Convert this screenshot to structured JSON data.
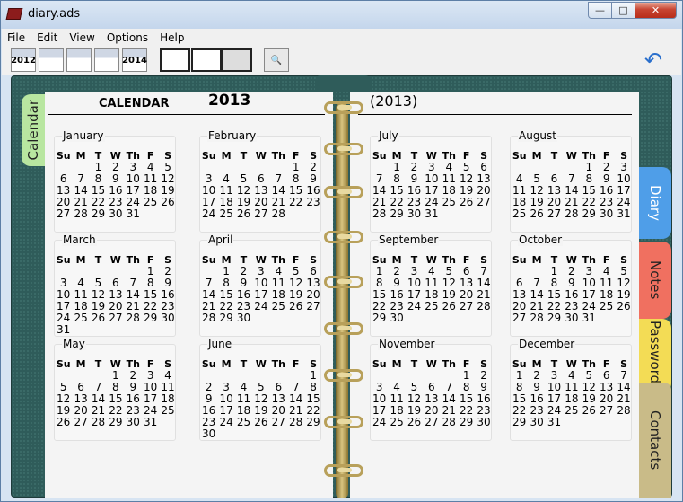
{
  "window": {
    "title": "diary.ads",
    "minimize": "—",
    "maximize": "□",
    "close": "✕"
  },
  "menu": [
    "File",
    "Edit",
    "View",
    "Options",
    "Help"
  ],
  "toolbar": {
    "year_prev": "2012",
    "year_next": "2014"
  },
  "left_page": {
    "label": "CALENDAR",
    "year": "2013"
  },
  "right_page": {
    "year": "(2013)"
  },
  "tabs": {
    "calendar": "Calendar",
    "diary": "Diary",
    "notes": "Notes",
    "passwords": "Passwords",
    "contacts": "Contacts"
  },
  "weekdays": [
    "Su",
    "M",
    "T",
    "W",
    "Th",
    "F",
    "S"
  ],
  "months": [
    {
      "name": "January",
      "weeks": [
        [
          "",
          "",
          "1",
          "2",
          "3",
          "4",
          "5"
        ],
        [
          "6",
          "7",
          "8",
          "9",
          "10",
          "11",
          "12"
        ],
        [
          "13",
          "14",
          "15",
          "16",
          "17",
          "18",
          "19"
        ],
        [
          "20",
          "21",
          "22",
          "23",
          "24",
          "25",
          "26"
        ],
        [
          "27",
          "28",
          "29",
          "30",
          "31",
          "",
          ""
        ]
      ]
    },
    {
      "name": "February",
      "weeks": [
        [
          "",
          "",
          "",
          "",
          "",
          "1",
          "2"
        ],
        [
          "3",
          "4",
          "5",
          "6",
          "7",
          "8",
          "9"
        ],
        [
          "10",
          "11",
          "12",
          "13",
          "14",
          "15",
          "16"
        ],
        [
          "17",
          "18",
          "19",
          "20",
          "21",
          "22",
          "23"
        ],
        [
          "24",
          "25",
          "26",
          "27",
          "28",
          "",
          ""
        ]
      ]
    },
    {
      "name": "March",
      "weeks": [
        [
          "",
          "",
          "",
          "",
          "",
          "1",
          "2"
        ],
        [
          "3",
          "4",
          "5",
          "6",
          "7",
          "8",
          "9"
        ],
        [
          "10",
          "11",
          "12",
          "13",
          "14",
          "15",
          "16"
        ],
        [
          "17",
          "18",
          "19",
          "20",
          "21",
          "22",
          "23"
        ],
        [
          "24",
          "25",
          "26",
          "27",
          "28",
          "29",
          "30"
        ],
        [
          "31",
          "",
          "",
          "",
          "",
          "",
          ""
        ]
      ]
    },
    {
      "name": "April",
      "weeks": [
        [
          "",
          "1",
          "2",
          "3",
          "4",
          "5",
          "6"
        ],
        [
          "7",
          "8",
          "9",
          "10",
          "11",
          "12",
          "13"
        ],
        [
          "14",
          "15",
          "16",
          "17",
          "18",
          "19",
          "20"
        ],
        [
          "21",
          "22",
          "23",
          "24",
          "25",
          "26",
          "27"
        ],
        [
          "28",
          "29",
          "30",
          "",
          "",
          "",
          ""
        ]
      ]
    },
    {
      "name": "May",
      "weeks": [
        [
          "",
          "",
          "",
          "1",
          "2",
          "3",
          "4"
        ],
        [
          "5",
          "6",
          "7",
          "8",
          "9",
          "10",
          "11"
        ],
        [
          "12",
          "13",
          "14",
          "15",
          "16",
          "17",
          "18"
        ],
        [
          "19",
          "20",
          "21",
          "22",
          "23",
          "24",
          "25"
        ],
        [
          "26",
          "27",
          "28",
          "29",
          "30",
          "31",
          ""
        ]
      ]
    },
    {
      "name": "June",
      "weeks": [
        [
          "",
          "",
          "",
          "",
          "",
          "",
          "1"
        ],
        [
          "2",
          "3",
          "4",
          "5",
          "6",
          "7",
          "8"
        ],
        [
          "9",
          "10",
          "11",
          "12",
          "13",
          "14",
          "15"
        ],
        [
          "16",
          "17",
          "18",
          "19",
          "20",
          "21",
          "22"
        ],
        [
          "23",
          "24",
          "25",
          "26",
          "27",
          "28",
          "29"
        ],
        [
          "30",
          "",
          "",
          "",
          "",
          "",
          ""
        ]
      ]
    },
    {
      "name": "July",
      "weeks": [
        [
          "",
          "1",
          "2",
          "3",
          "4",
          "5",
          "6"
        ],
        [
          "7",
          "8",
          "9",
          "10",
          "11",
          "12",
          "13"
        ],
        [
          "14",
          "15",
          "16",
          "17",
          "18",
          "19",
          "20"
        ],
        [
          "21",
          "22",
          "23",
          "24",
          "25",
          "26",
          "27"
        ],
        [
          "28",
          "29",
          "30",
          "31",
          "",
          "",
          ""
        ]
      ]
    },
    {
      "name": "August",
      "weeks": [
        [
          "",
          "",
          "",
          "",
          "1",
          "2",
          "3"
        ],
        [
          "4",
          "5",
          "6",
          "7",
          "8",
          "9",
          "10"
        ],
        [
          "11",
          "12",
          "13",
          "14",
          "15",
          "16",
          "17"
        ],
        [
          "18",
          "19",
          "20",
          "21",
          "22",
          "23",
          "24"
        ],
        [
          "25",
          "26",
          "27",
          "28",
          "29",
          "30",
          "31"
        ]
      ]
    },
    {
      "name": "September",
      "weeks": [
        [
          "1",
          "2",
          "3",
          "4",
          "5",
          "6",
          "7"
        ],
        [
          "8",
          "9",
          "10",
          "11",
          "12",
          "13",
          "14"
        ],
        [
          "15",
          "16",
          "17",
          "18",
          "19",
          "20",
          "21"
        ],
        [
          "22",
          "23",
          "24",
          "25",
          "26",
          "27",
          "28"
        ],
        [
          "29",
          "30",
          "",
          "",
          "",
          "",
          ""
        ]
      ]
    },
    {
      "name": "October",
      "weeks": [
        [
          "",
          "",
          "1",
          "2",
          "3",
          "4",
          "5"
        ],
        [
          "6",
          "7",
          "8",
          "9",
          "10",
          "11",
          "12"
        ],
        [
          "13",
          "14",
          "15",
          "16",
          "17",
          "18",
          "19"
        ],
        [
          "20",
          "21",
          "22",
          "23",
          "24",
          "25",
          "26"
        ],
        [
          "27",
          "28",
          "29",
          "30",
          "31",
          "",
          ""
        ]
      ]
    },
    {
      "name": "November",
      "weeks": [
        [
          "",
          "",
          "",
          "",
          "",
          "1",
          "2"
        ],
        [
          "3",
          "4",
          "5",
          "6",
          "7",
          "8",
          "9"
        ],
        [
          "10",
          "11",
          "12",
          "13",
          "14",
          "15",
          "16"
        ],
        [
          "17",
          "18",
          "19",
          "20",
          "21",
          "22",
          "23"
        ],
        [
          "24",
          "25",
          "26",
          "27",
          "28",
          "29",
          "30"
        ]
      ]
    },
    {
      "name": "December",
      "weeks": [
        [
          "1",
          "2",
          "3",
          "4",
          "5",
          "6",
          "7"
        ],
        [
          "8",
          "9",
          "10",
          "11",
          "12",
          "13",
          "14"
        ],
        [
          "15",
          "16",
          "17",
          "18",
          "19",
          "20",
          "21"
        ],
        [
          "22",
          "23",
          "24",
          "25",
          "26",
          "27",
          "28"
        ],
        [
          "29",
          "30",
          "31",
          "",
          "",
          "",
          ""
        ]
      ]
    }
  ]
}
